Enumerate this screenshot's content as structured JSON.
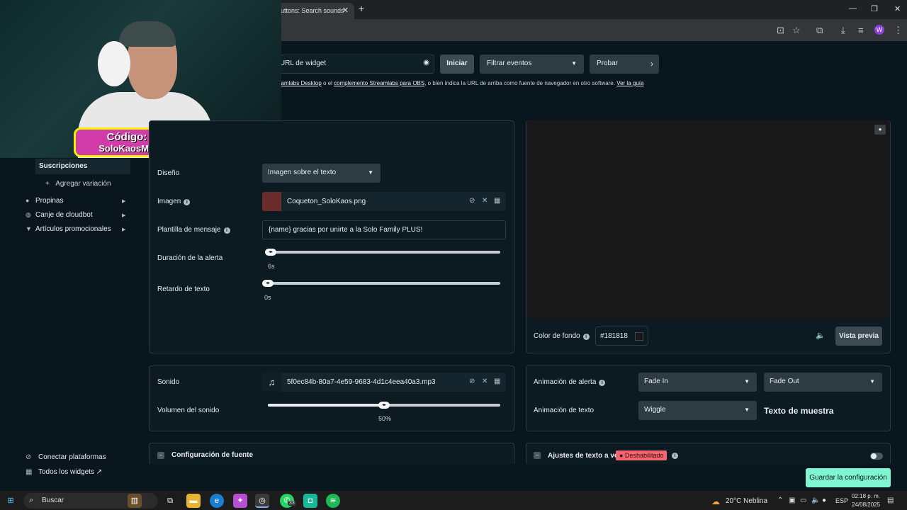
{
  "browser": {
    "tab_title": "uttons: Search sounds",
    "tab_close": "✕",
    "new_tab": "+",
    "profile_letter": "W"
  },
  "webcam": {
    "promo_line1": "Código:",
    "promo_line2": "SoloKaosMX"
  },
  "top": {
    "url_label": "iar URL de widget",
    "start_label": "Iniciar",
    "filter_label": "Filtrar eventos",
    "test_label": "Probar",
    "info_pre": "eamlabs Desktop",
    "info_mid1": " o el ",
    "info_link2": "complemento Streamlabs para OBS",
    "info_mid2": ", o bien indica la URL de arriba como fuente de navegador en otro software. ",
    "info_link3": "Ver la guía"
  },
  "sidebar": {
    "active": "Suscripciones",
    "add_variation": "Agregar variación",
    "items": [
      {
        "label": "Propinas",
        "icon": "coins-icon"
      },
      {
        "label": "Canje de cloudbot",
        "icon": "chat-icon"
      },
      {
        "label": "Artículos promocionales",
        "icon": "shirt-icon"
      }
    ],
    "connect": "Conectar plataformas",
    "all_widgets": "Todos los widgets"
  },
  "settings": {
    "design_label": "Diseño",
    "design_value": "Imagen sobre el texto",
    "image_label": "Imagen",
    "image_file": "Coqueton_SoloKaos.png",
    "template_label": "Plantilla de mensaje",
    "template_value": "{name} gracias por unirte a la Solo Family PLUS!",
    "duration_label": "Duración de la alerta",
    "duration_value": "6s",
    "delay_label": "Retardo de texto",
    "delay_value": "0s"
  },
  "preview": {
    "bg_label": "Color de fondo",
    "bg_value": "#181818",
    "preview_button": "Vista previa"
  },
  "sound": {
    "sound_label": "Sonido",
    "sound_file": "5f0ec84b-80a7-4e59-9683-4d1c4eea40a3.mp3",
    "volume_label": "Volumen del sonido",
    "volume_value": "50%",
    "volume_fraction": 0.5
  },
  "animation": {
    "alert_label": "Animación de alerta",
    "alert_in": "Fade In",
    "alert_out": "Fade Out",
    "text_label": "Animación de texto",
    "text_value": "Wiggle",
    "sample_text": "Texto de muestra"
  },
  "sections": {
    "font_config": "Configuración de fuente",
    "tts": "Ajustes de texto a voz",
    "tts_badge": "● Deshabilitado"
  },
  "save_button": "Guardar la configuración",
  "taskbar": {
    "search": "Buscar",
    "weather": "20°C  Neblina",
    "lang": "ESP",
    "time": "02:18 p. m.",
    "date": "24/08/2025",
    "whatsapp_badge": "33"
  },
  "colors": {
    "accent": "#80f5d2",
    "danger": "#f26670",
    "background": "#09161d"
  }
}
